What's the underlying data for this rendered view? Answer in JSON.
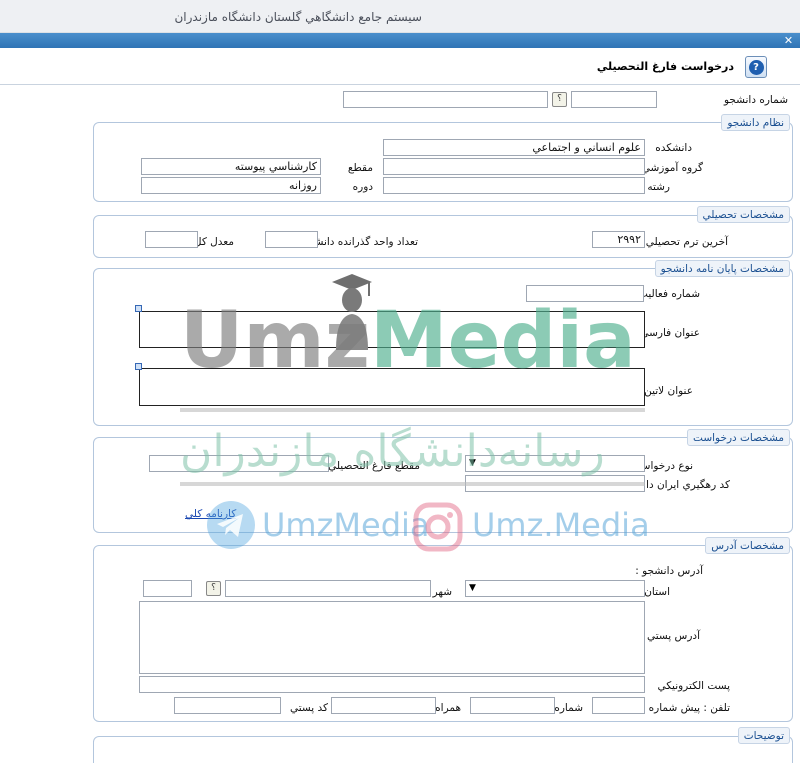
{
  "app": {
    "title": "سيستم جامع دانشگاهي گلستان   دانشگاه مازندران"
  },
  "form": {
    "title": "درخواست فارغ التحصيلي"
  },
  "student": {
    "id_label": "شماره دانشجو",
    "id_value": "",
    "name_value": "",
    "lookup_button": "؟"
  },
  "education_system": {
    "legend": "نظام دانشجو",
    "faculty_label": "دانشكده",
    "faculty_value": "علوم انساني و اجتماعي",
    "department_label": "گروه آموزشي",
    "department_value": "",
    "field_label": "رشته",
    "field_value": "",
    "degree_label": "مقطع",
    "degree_value": "كارشناسي پيوسته",
    "course_label": "دوره",
    "course_value": "روزانه"
  },
  "academic": {
    "legend": "مشخصات تحصيلي",
    "last_term_label": "آخرين ترم تحصيلي",
    "last_term_value": "۲۹۹۲",
    "units_label": "تعداد واحد گذرانده دانشجو",
    "units_value": "",
    "gpa_label": "معدل كل",
    "gpa_value": ""
  },
  "thesis": {
    "legend": "مشخصات پايان نامه دانشجو",
    "activity_label": "شماره فعاليت",
    "activity_value": "",
    "persian_title_label": "عنوان فارسي",
    "latin_title_label": "عنوان لاتين"
  },
  "request": {
    "legend": "مشخصات درخواست",
    "type_label": "نوع درخواست",
    "type_value": "",
    "grad_degree_label": "مقطع فارغ التحصيلي",
    "grad_degree_value": "",
    "tracking_label": "كد رهگيري ايران داك",
    "tracking_value": "",
    "transcript_link": "كارنامه كلي"
  },
  "address": {
    "legend": "مشخصات آدرس",
    "student_address_label": "آدرس دانشجو :",
    "province_label": "استان",
    "province_value": "",
    "city_label": "شهر",
    "city_value": "",
    "city_lookup": "؟",
    "postal_address_label": "آدرس پستي",
    "email_label": "پست الكترونيكي",
    "email_value": "",
    "phone_label": "تلفن : پيش شماره",
    "phone_prefix_value": "",
    "number_label": "شماره",
    "number_value": "",
    "mobile_label": "همراه",
    "mobile_value": "",
    "postal_code_label": "كد پستي",
    "postal_code_value": ""
  },
  "notes": {
    "legend": "توضيحات"
  },
  "watermark": {
    "brand": "UmzMedia",
    "tagline": "رسانه‌دانشگاه مازندران",
    "telegram": "UmzMedia",
    "instagram": "Umz.Media"
  },
  "icons": {
    "help": "help-icon",
    "close": "close-icon",
    "telegram": "telegram-icon",
    "instagram": "instagram-icon",
    "mascot": "graduate-icon"
  },
  "colors": {
    "title_strip": "#3a82c4",
    "legend_text": "#1a4f91",
    "watermark_gray": "#808080",
    "watermark_teal": "#4fb08f"
  }
}
